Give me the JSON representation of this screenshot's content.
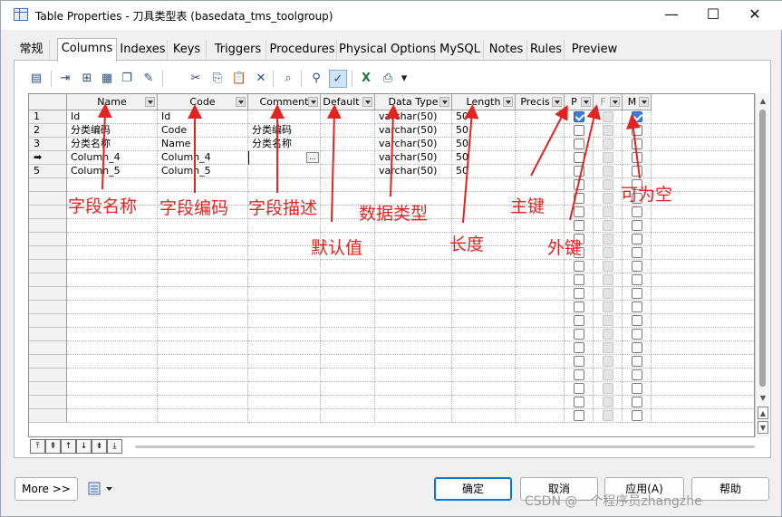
{
  "window": {
    "title": "Table Properties - 刀具类型表 (basedata_tms_toolgroup)",
    "minimize": "—",
    "maximize": "☐",
    "close": "✕"
  },
  "tabs": [
    {
      "label": "常规",
      "active": false
    },
    {
      "label": "Columns",
      "active": true
    },
    {
      "label": "Indexes",
      "active": false
    },
    {
      "label": "Keys",
      "active": false
    },
    {
      "label": "Triggers",
      "active": false
    },
    {
      "label": "Procedures",
      "active": false
    },
    {
      "label": "Physical Options",
      "active": false
    },
    {
      "label": "MySQL",
      "active": false
    },
    {
      "label": "Notes",
      "active": false
    },
    {
      "label": "Rules",
      "active": false
    },
    {
      "label": "Preview",
      "active": false
    }
  ],
  "toolbar": {
    "icons": [
      "properties-icon",
      "insert-row-icon",
      "add-row-icon",
      "add-columns-icon",
      "copy-columns-icon",
      "filter-icon",
      "cut-icon",
      "copy-icon",
      "paste-icon",
      "delete-icon",
      "find-icon",
      "customize-columns-icon",
      "filter-toggle-icon",
      "excel-export-icon",
      "print-icon",
      "more-dropdown-icon"
    ],
    "glyphs": [
      "▤",
      "⇥",
      "⊞",
      "▦",
      "❐",
      "✎",
      "✂",
      "⎘",
      "📋",
      "✕",
      "⌕",
      "⚲",
      "✓",
      "X",
      "⎙",
      "▾"
    ]
  },
  "grid": {
    "headers": [
      "Name",
      "Code",
      "Comment",
      "Default",
      "Data Type",
      "Length",
      "Precis",
      "P",
      "F",
      "M"
    ],
    "rows": [
      {
        "num": "1",
        "name": "Id",
        "code": "Id",
        "comment": "",
        "default": "",
        "type": "varchar(50)",
        "length": "50",
        "p": true,
        "f": false,
        "m": true
      },
      {
        "num": "2",
        "name": "分类编码",
        "code": "Code",
        "comment": "分类编码",
        "default": "",
        "type": "varchar(50)",
        "length": "50",
        "p": false,
        "f": false,
        "m": false
      },
      {
        "num": "3",
        "name": "分类名称",
        "code": "Name",
        "comment": "分类名称",
        "default": "",
        "type": "varchar(50)",
        "length": "50",
        "p": false,
        "f": false,
        "m": false
      },
      {
        "num": "➡",
        "name": "Column_4",
        "code": "Column_4",
        "comment": "",
        "default": "",
        "type": "varchar(50)",
        "length": "50",
        "p": false,
        "f": false,
        "m": false
      },
      {
        "num": "5",
        "name": "Column_5",
        "code": "Column_5",
        "comment": "",
        "default": "",
        "type": "varchar(50)",
        "length": "50",
        "p": false,
        "f": false,
        "m": false
      }
    ],
    "edit_button": "...",
    "total_rows": 23
  },
  "navigation": {
    "buttons": [
      "⤒",
      "⇞",
      "↑",
      "↓",
      "⇟",
      "⤓"
    ]
  },
  "annotations": {
    "name": "字段名称",
    "code": "字段编码",
    "comment": "字段描述",
    "default": "默认值",
    "datatype": "数据类型",
    "length": "长度",
    "primary": "主键",
    "foreign": "外键",
    "nullable": "可为空"
  },
  "footer": {
    "more": "More >>",
    "ok": "确定",
    "cancel": "取消",
    "apply": "应用(A)",
    "help": "帮助",
    "watermark": "CSDN @一个程序员zhangzhe"
  }
}
